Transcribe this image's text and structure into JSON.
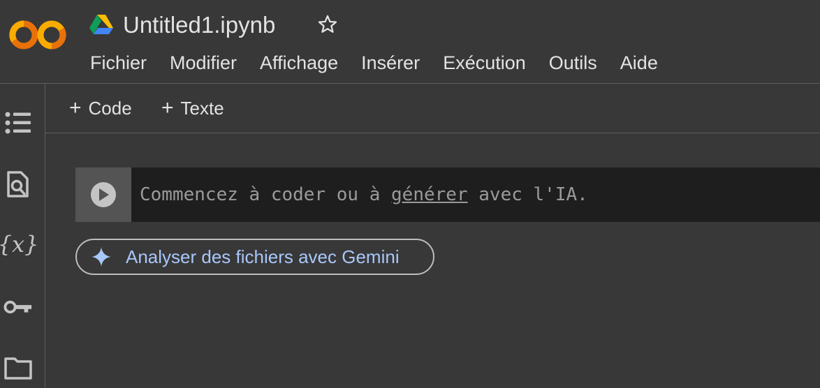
{
  "app": {
    "logo": "colab-logo",
    "drive_icon": "google-drive-icon",
    "notebook_title": "Untitled1.ipynb",
    "star_icon": "star-outline-icon"
  },
  "menu": [
    {
      "label": "Fichier"
    },
    {
      "label": "Modifier"
    },
    {
      "label": "Affichage"
    },
    {
      "label": "Insérer"
    },
    {
      "label": "Exécution"
    },
    {
      "label": "Outils"
    },
    {
      "label": "Aide"
    }
  ],
  "sidebar": [
    {
      "icon": "table-of-contents-icon"
    },
    {
      "icon": "find-replace-icon"
    },
    {
      "icon": "variables-icon",
      "glyph": "{𝑥}"
    },
    {
      "icon": "secrets-key-icon"
    },
    {
      "icon": "files-folder-icon"
    }
  ],
  "toolbar": {
    "add_code_label": "Code",
    "add_text_label": "Texte",
    "plus_glyph": "+"
  },
  "cell": {
    "run_icon": "play-circle-icon",
    "placeholder_before": "Commencez à coder ou à ",
    "placeholder_link": "générer",
    "placeholder_after": " avec l'IA."
  },
  "gemini": {
    "icon": "gemini-sparkle-icon",
    "label": "Analyser des fichiers avec Gemini"
  },
  "colors": {
    "background": "#383838",
    "cell_background": "#1e1e1e",
    "gemini_accent": "#a8c7fa",
    "logo_orange": "#f9ab00",
    "logo_dark_orange": "#e8710a"
  }
}
